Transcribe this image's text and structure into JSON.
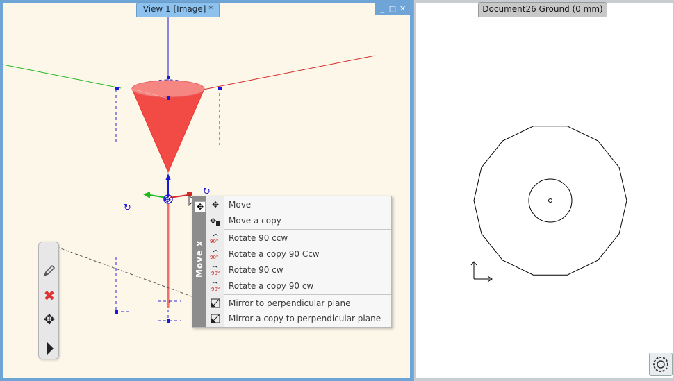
{
  "views": {
    "left": {
      "title": "View 1 [Image] *"
    },
    "right": {
      "title": "Document26 Ground (0 mm)"
    }
  },
  "window_controls": {
    "minimize": "_",
    "maximize": "□",
    "close": "✕"
  },
  "context_menu": {
    "side_label": "Move x",
    "items": [
      {
        "label": "Move",
        "icon": "move-icon"
      },
      {
        "label": "Move a copy",
        "icon": "move-copy-icon"
      },
      {
        "label": "Rotate 90 ccw",
        "icon": "rotate-ccw-icon"
      },
      {
        "label": "Rotate a copy 90 Ccw",
        "icon": "rotate-copy-ccw-icon"
      },
      {
        "label": "Rotate 90 cw",
        "icon": "rotate-cw-icon"
      },
      {
        "label": "Rotate a copy 90 cw",
        "icon": "rotate-copy-cw-icon"
      },
      {
        "label": "Mirror to perpendicular plane",
        "icon": "mirror-icon"
      },
      {
        "label": "Mirror a copy to perpendicular plane",
        "icon": "mirror-copy-icon"
      }
    ],
    "icon_glyphs": {
      "move": "✥",
      "rotate_badge": "90°"
    }
  },
  "toolbar": {
    "items": [
      "pencil-icon",
      "delete-icon",
      "move-icon",
      "expand-arrow-icon"
    ]
  },
  "colors": {
    "view_accent": "#6fa4d6",
    "cone_red": "#f24a45",
    "axis_x": "#d62828",
    "axis_y": "#1fb81f",
    "axis_z": "#1a1ad6",
    "delete_red": "#e03030"
  }
}
